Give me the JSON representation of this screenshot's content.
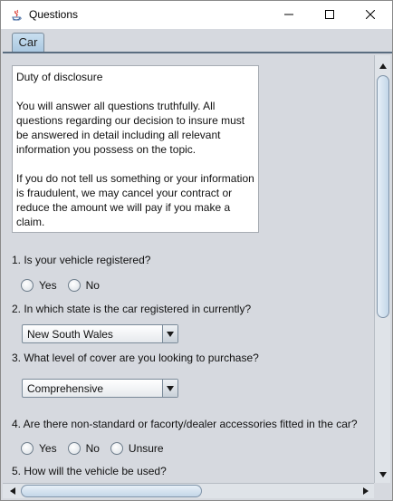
{
  "window": {
    "title": "Questions",
    "app_icon": "java-icon",
    "controls": [
      "minimize-icon",
      "maximize-icon",
      "close-icon"
    ]
  },
  "tabs": [
    {
      "label": "Car",
      "selected": true
    }
  ],
  "disclosure": {
    "heading": "Duty of disclosure",
    "paragraph1": "You will answer all questions truthfully. All questions regarding our decision to insure must be answered in detail including all relevant information you possess on the topic.",
    "paragraph2": "If you do not tell us something or your information is fraudulent, we may cancel your contract or reduce the amount we will pay if you make a claim."
  },
  "questions": {
    "q1": {
      "text": "1. Is your vehicle registered?",
      "options": [
        "Yes",
        "No"
      ]
    },
    "q2": {
      "text": "2. In which state is the car registered in currently?",
      "selected": "New South Wales"
    },
    "q3": {
      "text": "3. What level of cover are you looking to purchase?",
      "selected": "Comprehensive"
    },
    "q4": {
      "text": "4. Are there non-standard or facorty/dealer accessories fitted in the car?",
      "options": [
        "Yes",
        "No",
        "Unsure"
      ]
    },
    "q5": {
      "text": "5. How will the vehicle be used?"
    }
  },
  "colors": {
    "panel_bg": "#d6d9df",
    "tab_bg": "#b7d0e6",
    "scroll_thumb": "#c3d6e8"
  }
}
